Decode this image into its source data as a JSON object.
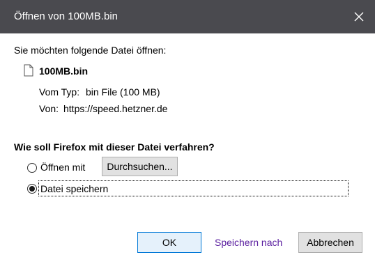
{
  "window": {
    "title": "Öffnen von 100MB.bin",
    "close_icon": "close-icon"
  },
  "prompt": "Sie möchten folgende Datei öffnen:",
  "file": {
    "icon": "file-icon",
    "name": "100MB.bin",
    "type_label": "Vom Typ:",
    "type_value": "bin File (100 MB)",
    "from_label": "Von:",
    "from_value": "https://speed.hetzner.de"
  },
  "question": "Wie soll Firefox mit dieser Datei verfahren?",
  "options": {
    "open_with_label": "Öffnen mit",
    "browse_label": "Durchsuchen...",
    "save_label": "Datei speichern",
    "selected": "save"
  },
  "actions": {
    "ok_label": "OK",
    "save_as_label": "Speichern nach",
    "cancel_label": "Abbrechen"
  },
  "colors": {
    "titlebar": "#4a4a4f",
    "link": "#5a1e9f",
    "ok_border": "#0078d7"
  }
}
